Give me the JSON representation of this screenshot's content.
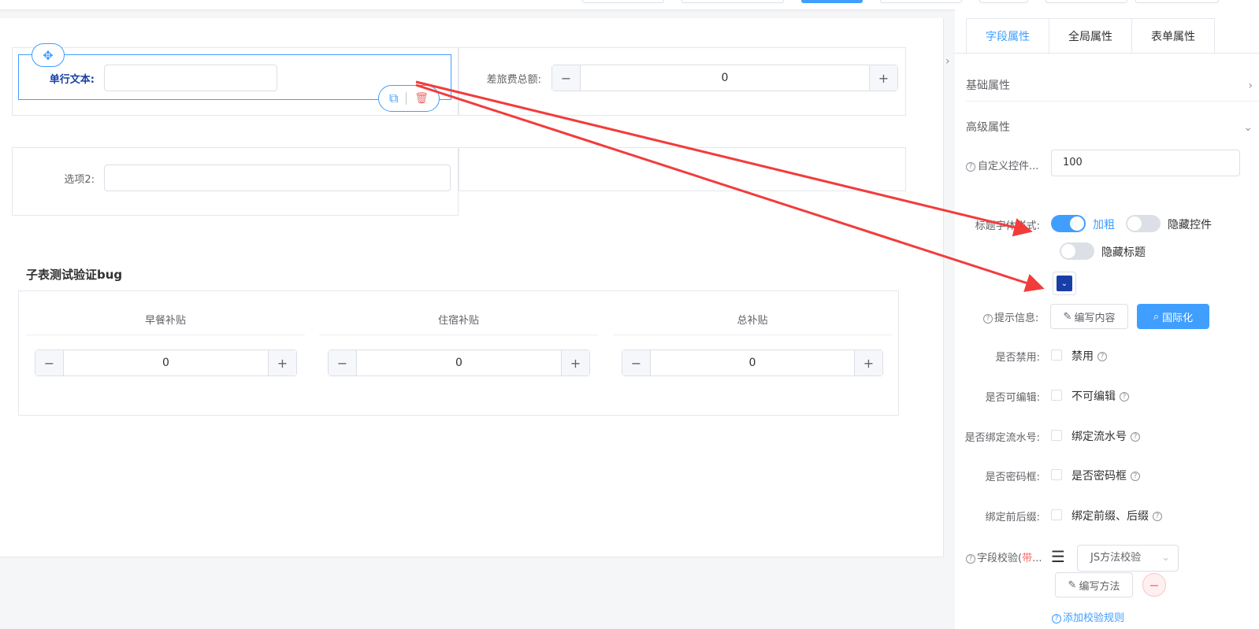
{
  "canvas": {
    "row1": {
      "selected_field": {
        "label": "单行文本:",
        "value": ""
      },
      "travel_total": {
        "label": "差旅费总额:",
        "value": "0"
      }
    },
    "row2": {
      "option_field": {
        "label": "选项2:",
        "value": ""
      }
    },
    "subtable": {
      "title": "子表测试验证bug",
      "columns": [
        {
          "header": "早餐补贴",
          "value": "0"
        },
        {
          "header": "住宿补贴",
          "value": "0"
        },
        {
          "header": "总补贴",
          "value": "0"
        }
      ]
    }
  },
  "panel": {
    "tabs": [
      {
        "label": "字段属性",
        "active": true
      },
      {
        "label": "全局属性",
        "active": false
      },
      {
        "label": "表单属性",
        "active": false
      }
    ],
    "basic_section": "基础属性",
    "advanced_section": "高级属性",
    "custom_width": {
      "label": "自定义控件...",
      "value": "100"
    },
    "title_style": {
      "label": "标题字体样式:",
      "bold": {
        "label": "加粗",
        "on": true
      },
      "hide_control": {
        "label": "隐藏控件",
        "on": false
      },
      "hide_title": {
        "label": "隐藏标题",
        "on": false
      },
      "color": "#1a3ea8"
    },
    "tip_info": {
      "label": "提示信息:",
      "edit_btn": "编写内容",
      "i18n_btn": "国际化"
    },
    "disabled": {
      "label": "是否禁用:",
      "option": "禁用"
    },
    "editable": {
      "label": "是否可编辑:",
      "option": "不可编辑"
    },
    "serial": {
      "label": "是否绑定流水号:",
      "option": "绑定流水号"
    },
    "password": {
      "label": "是否密码框:",
      "option": "是否密码框"
    },
    "prefix_suffix": {
      "label": "绑定前后缀:",
      "option": "绑定前缀、后缀"
    },
    "validation": {
      "label_main": "字段校验(",
      "label_red": "带",
      "label_tail": "...",
      "method": "JS方法校验",
      "write_btn": "编写方法",
      "add_rule": "添加校验规则"
    }
  },
  "colors": {
    "primary": "#409eff",
    "danger": "#f56c6c",
    "arrow": "#f23c3c"
  }
}
